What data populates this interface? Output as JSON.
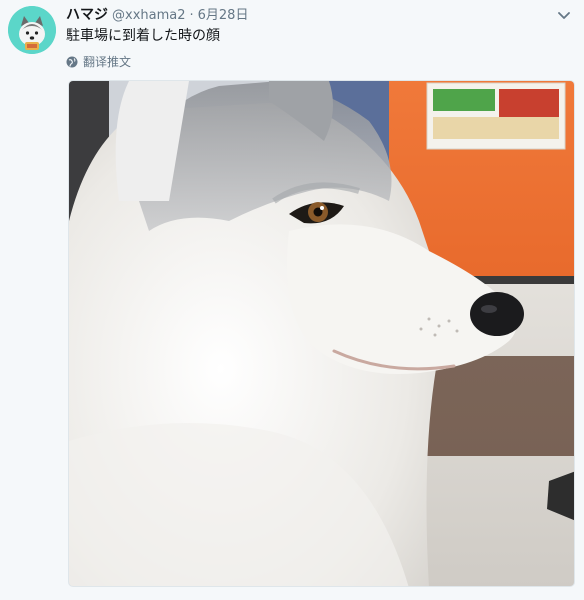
{
  "tweet": {
    "display_name": "ハマジ",
    "handle": "@xxhama2",
    "separator": "·",
    "date": "6月28日",
    "text": "駐車場に到着した時の顔",
    "translate_label": "翻译推文"
  },
  "icons": {
    "avatar": "avatar-illustration",
    "caret": "chevron-down-icon",
    "globe": "globe-icon"
  },
  "colors": {
    "background": "#f5f8fa",
    "avatar_bg": "#5bd6c9",
    "muted_text": "#657786",
    "body_text": "#14171a"
  }
}
